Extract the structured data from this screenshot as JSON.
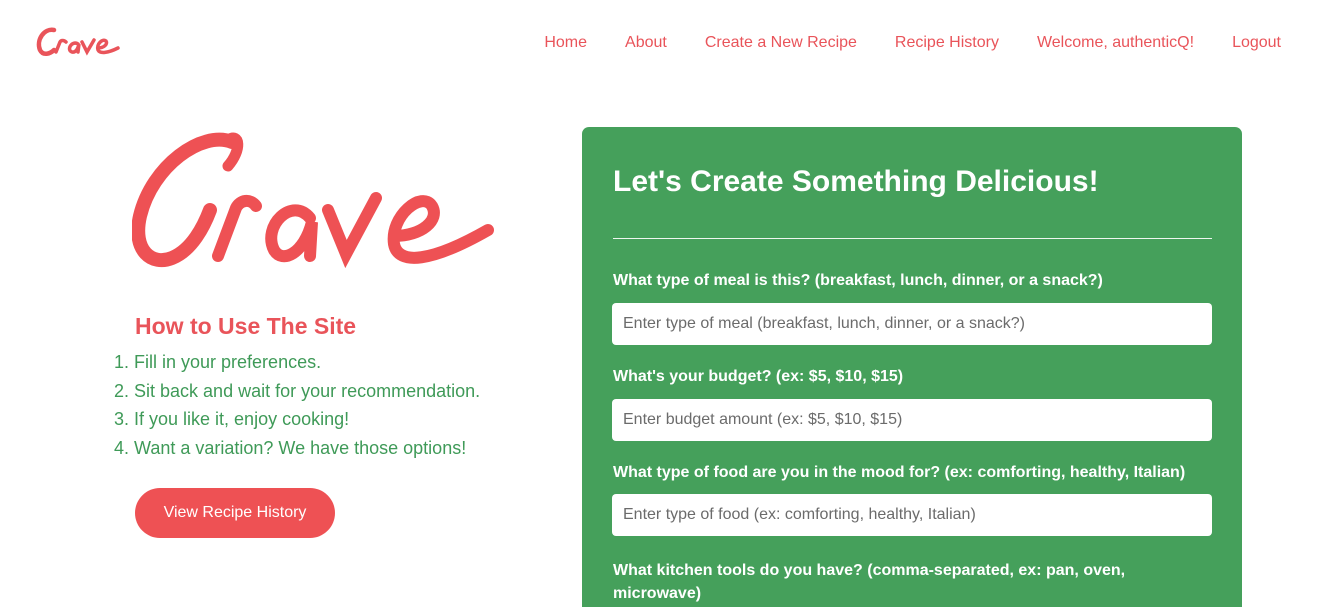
{
  "brand": {
    "name": "Crave",
    "color": "#e9545a",
    "accent_green": "#45a05b"
  },
  "nav": {
    "links": [
      {
        "label": "Home"
      },
      {
        "label": "About"
      },
      {
        "label": "Create a New Recipe"
      },
      {
        "label": "Recipe History"
      },
      {
        "label": "Welcome, authenticQ!"
      },
      {
        "label": "Logout"
      }
    ]
  },
  "sidebar": {
    "title": "How to Use The Site",
    "steps": [
      "1. Fill in your preferences.",
      "2. Sit back and wait for your recommendation.",
      "3. If you like it, enjoy cooking!",
      "4. Want a variation? We have those options!"
    ],
    "button_label": "View Recipe History"
  },
  "form": {
    "title": "Let's Create Something Delicious!",
    "fields": [
      {
        "label": "What type of meal is this? (breakfast, lunch, dinner, or a snack?)",
        "placeholder": "Enter type of meal (breakfast, lunch, dinner, or a snack?)",
        "value": ""
      },
      {
        "label": "What's your budget? (ex: $5, $10, $15)",
        "placeholder": "Enter budget amount (ex: $5, $10, $15)",
        "value": ""
      },
      {
        "label": "What type of food are you in the mood for? (ex: comforting, healthy, Italian)",
        "placeholder": "Enter type of food (ex: comforting, healthy, Italian)",
        "value": ""
      },
      {
        "label": "What kitchen tools do you have? (comma-separated, ex: pan, oven, microwave)"
      }
    ]
  }
}
